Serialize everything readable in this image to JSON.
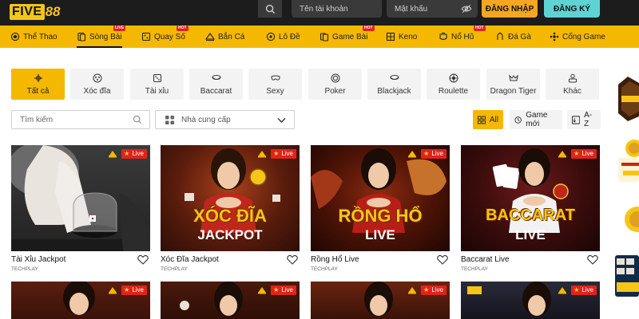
{
  "header": {
    "logo_text": "FIVE",
    "logo_number": "88",
    "username_placeholder": "Tên tài khoản",
    "password_placeholder": "Mật khẩu",
    "login_label": "ĐĂNG NHẬP",
    "register_label": "ĐĂNG KÝ"
  },
  "nav": {
    "items": [
      {
        "label": "Thể Thao",
        "icon": "sport-icon"
      },
      {
        "label": "Sòng Bài",
        "icon": "casino-icon",
        "tag": "LIVE"
      },
      {
        "label": "Quay Số",
        "icon": "lottery-icon",
        "tag": "HOT"
      },
      {
        "label": "Bắn Cá",
        "icon": "fish-icon"
      },
      {
        "label": "Lô Đề",
        "icon": "number-icon"
      },
      {
        "label": "Game Bài",
        "icon": "cards-icon",
        "tag": "HOT"
      },
      {
        "label": "Keno",
        "icon": "keno-icon"
      },
      {
        "label": "Nổ Hũ",
        "icon": "jackpot-icon",
        "tag": "HOT"
      },
      {
        "label": "Đá Gà",
        "icon": "rooster-icon"
      },
      {
        "label": "Cổng Game",
        "icon": "gate-icon"
      }
    ]
  },
  "filters": {
    "tabs": [
      {
        "label": "Tất cả",
        "icon": "all-icon"
      },
      {
        "label": "Xóc đĩa",
        "icon": "disc-icon"
      },
      {
        "label": "Tài xỉu",
        "icon": "dice-icon"
      },
      {
        "label": "Baccarat",
        "icon": "baccarat-icon"
      },
      {
        "label": "Sexy",
        "icon": "mask-icon"
      },
      {
        "label": "Poker",
        "icon": "poker-icon"
      },
      {
        "label": "Blackjack",
        "icon": "blackjack-icon"
      },
      {
        "label": "Roulette",
        "icon": "roulette-icon"
      },
      {
        "label": "Dragon Tiger",
        "icon": "dragon-icon"
      },
      {
        "label": "Khác",
        "icon": "other-icon"
      }
    ],
    "search_placeholder": "Tìm kiếm",
    "provider_placeholder": "Nhà cung cấp",
    "sort_all": "All",
    "sort_new": "Game mới",
    "sort_az": "A-Z"
  },
  "games": [
    {
      "title": "Tài Xỉu Jackpot",
      "provider": "TECHPLAY",
      "live": "Live",
      "overlay_line1": "",
      "overlay_line2": ""
    },
    {
      "title": "Xóc Đĩa Jackpot",
      "provider": "TECHPLAY",
      "live": "Live",
      "overlay_line1": "XÓC ĐĨA",
      "overlay_line2": "JACKPOT"
    },
    {
      "title": "Rồng Hổ Live",
      "provider": "TECHPLAY",
      "live": "Live",
      "overlay_line1": "RỒNG HỔ",
      "overlay_line2": "LIVE"
    },
    {
      "title": "Baccarat Live",
      "provider": "TECHPLAY",
      "live": "Live",
      "overlay_line1": "BACCARAT",
      "overlay_line2": "LIVE"
    }
  ],
  "games_row2": [
    {
      "live": "Live"
    },
    {
      "live": "Live"
    },
    {
      "live": "Live"
    },
    {
      "live": "Live"
    }
  ],
  "colors": {
    "accent": "#f5b800",
    "header_bg": "#1c1c1c",
    "live_red": "#e0231b",
    "register": "#5fd3d3",
    "login": "#f5a623"
  }
}
